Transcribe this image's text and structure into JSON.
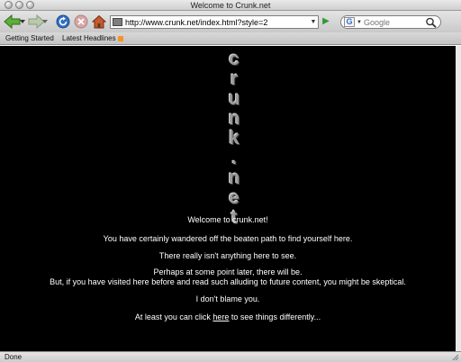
{
  "window": {
    "title": "Welcome to Crunk.net"
  },
  "toolbar": {
    "url": "http://www.crunk.net/index.html?style=2",
    "search_placeholder": "Google"
  },
  "bookmarks": [
    {
      "label": "Getting Started"
    },
    {
      "label": "Latest Headlines"
    }
  ],
  "page": {
    "logo_letters": [
      "c",
      "r",
      "u",
      "n",
      "k",
      ".",
      "n",
      "e",
      "t"
    ],
    "lines": [
      "Welcome to crunk.net!",
      "You have certainly wandered off the beaten path to find yourself here.",
      "There really isn't anything here to see.",
      "Perhaps at some point later, there will be.",
      "But, if you have visited here before and read such alluding to future content, you might be skeptical.",
      "I don't blame you."
    ],
    "last_line": {
      "before": "At least you can click ",
      "link": "here",
      "after": " to see things differently..."
    }
  },
  "status": {
    "text": "Done"
  },
  "colors": {
    "page_background": "#000000",
    "page_text": "#ffffff"
  }
}
